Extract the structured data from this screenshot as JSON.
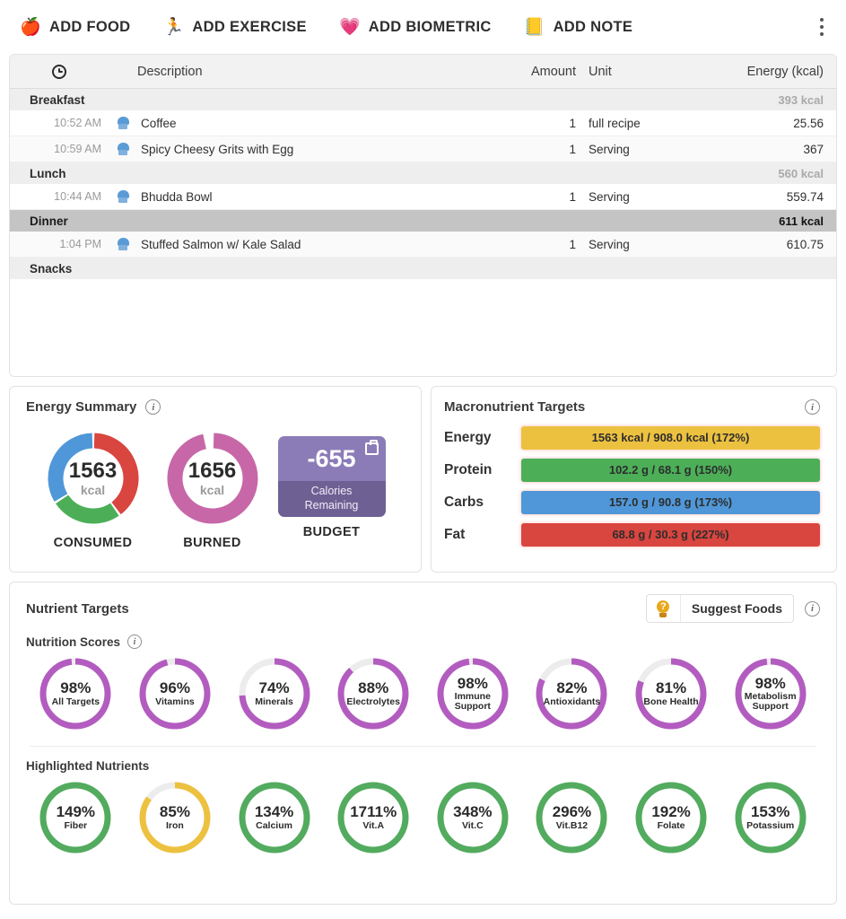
{
  "toolbar": {
    "actions": [
      {
        "label": "ADD FOOD",
        "icon": "apple-icon",
        "glyph": "🍎"
      },
      {
        "label": "ADD EXERCISE",
        "icon": "runner-icon",
        "glyph": "🏃"
      },
      {
        "label": "ADD BIOMETRIC",
        "icon": "heart-pulse-icon",
        "glyph": "💗"
      },
      {
        "label": "ADD NOTE",
        "icon": "note-icon",
        "glyph": "📒"
      }
    ],
    "overflow_icon": "kebab-menu-icon"
  },
  "log": {
    "columns": {
      "time": "",
      "time_icon": "clock-icon",
      "description": "Description",
      "amount": "Amount",
      "unit": "Unit",
      "energy": "Energy (kcal)"
    },
    "sections": [
      {
        "name": "Breakfast",
        "kcal": "393 kcal",
        "highlighted": false,
        "items": [
          {
            "time": "10:52 AM",
            "icon": "chef-hat-icon",
            "description": "Coffee",
            "amount": "1",
            "unit": "full recipe",
            "energy": "25.56"
          },
          {
            "time": "10:59 AM",
            "icon": "chef-hat-icon",
            "description": "Spicy Cheesy Grits with Egg",
            "amount": "1",
            "unit": "Serving",
            "energy": "367"
          }
        ]
      },
      {
        "name": "Lunch",
        "kcal": "560 kcal",
        "highlighted": false,
        "items": [
          {
            "time": "10:44 AM",
            "icon": "chef-hat-icon",
            "description": "Bhudda Bowl",
            "amount": "1",
            "unit": "Serving",
            "energy": "559.74"
          }
        ]
      },
      {
        "name": "Dinner",
        "kcal": "611 kcal",
        "highlighted": true,
        "items": [
          {
            "time": "1:04 PM",
            "icon": "chef-hat-icon",
            "description": "Stuffed Salmon w/ Kale Salad",
            "amount": "1",
            "unit": "Serving",
            "energy": "610.75"
          }
        ]
      },
      {
        "name": "Snacks",
        "kcal": "",
        "highlighted": false,
        "items": []
      }
    ]
  },
  "energy_summary": {
    "title": "Energy Summary",
    "info_icon": "info-icon",
    "consumed": {
      "value": "1563",
      "unit": "kcal",
      "caption": "CONSUMED",
      "segments": [
        {
          "name": "Fat",
          "percent": 40,
          "color": "#d9453f"
        },
        {
          "name": "Protein",
          "percent": 26,
          "color": "#4aa css"
        }
      ]
    },
    "burned": {
      "value": "1656",
      "unit": "kcal",
      "caption": "BURNED",
      "percent": 97,
      "color": "#c767a8"
    },
    "budget": {
      "value": "-655",
      "label_line1": "Calories",
      "label_line2": "Remaining",
      "caption": "BUDGET",
      "icon": "budget-bag-icon",
      "color_top": "#8b7cb8",
      "color_bottom": "#6f6094"
    }
  },
  "chart_data": [
    {
      "type": "pie",
      "title": "CONSUMED",
      "center_label": "1563 kcal",
      "categories": [
        "Fat",
        "Protein",
        "Carbs"
      ],
      "values": [
        40,
        26,
        34
      ],
      "colors": [
        "#d9453f",
        "#4caf58",
        "#4f97d8"
      ],
      "unit": "% of consumed energy"
    },
    {
      "type": "pie",
      "title": "BURNED",
      "center_label": "1656 kcal",
      "categories": [
        "Burned"
      ],
      "values": [
        97
      ],
      "colors": [
        "#c767a8"
      ],
      "unit": "%"
    },
    {
      "type": "bar",
      "title": "Macronutrient Targets",
      "categories": [
        "Energy",
        "Protein",
        "Carbs",
        "Fat"
      ],
      "values": [
        172,
        150,
        173,
        227
      ],
      "colors": [
        "#edc140",
        "#4aa css",
        "#4f97d8",
        "#d9453f"
      ],
      "ylabel": "% of target",
      "grid": false
    },
    {
      "type": "bar",
      "title": "Nutrition Scores",
      "categories": [
        "All Targets",
        "Vitamins",
        "Minerals",
        "Electrolytes",
        "Immune Support",
        "Antioxidants",
        "Bone Health",
        "Metabolism Support"
      ],
      "values": [
        98,
        96,
        74,
        88,
        98,
        82,
        81,
        98
      ],
      "ylabel": "%",
      "ylim": [
        0,
        100
      ]
    },
    {
      "type": "bar",
      "title": "Highlighted Nutrients",
      "categories": [
        "Fiber",
        "Iron",
        "Calcium",
        "Vit.A",
        "Vit.C",
        "Vit.B12",
        "Folate",
        "Potassium"
      ],
      "values": [
        149,
        85,
        134,
        1711,
        348,
        296,
        192,
        153
      ],
      "ylabel": "% of target"
    }
  ],
  "macro": {
    "title": "Macronutrient Targets",
    "info_icon": "info-icon",
    "rows": [
      {
        "name": "Energy",
        "text": "1563 kcal / 908.0 kcal (172%)",
        "percent": 172,
        "color": "#edc140"
      },
      {
        "name": "Protein",
        "text": "102.2 g / 68.1 g (150%)",
        "percent": 150,
        "color": "#4caf58"
      },
      {
        "name": "Carbs",
        "text": "157.0 g / 90.8 g (173%)",
        "percent": 173,
        "color": "#4f97d8"
      },
      {
        "name": "Fat",
        "text": "68.8 g / 30.3 g (227%)",
        "percent": 227,
        "color": "#d9453f"
      }
    ]
  },
  "nutrient_targets": {
    "title": "Nutrient Targets",
    "info_icon": "info-icon",
    "suggest_button": {
      "label": "Suggest Foods",
      "icon": "lightbulb-question-icon"
    },
    "scores": {
      "title": "Nutrition Scores",
      "info_icon": "info-icon",
      "color": "#b35cc0",
      "track": "#ececec",
      "items": [
        {
          "pct": "98%",
          "value": 98,
          "name": "All Targets"
        },
        {
          "pct": "96%",
          "value": 96,
          "name": "Vitamins"
        },
        {
          "pct": "74%",
          "value": 74,
          "name": "Minerals"
        },
        {
          "pct": "88%",
          "value": 88,
          "name": "Electrolytes"
        },
        {
          "pct": "98%",
          "value": 98,
          "name": "Immune Support"
        },
        {
          "pct": "82%",
          "value": 82,
          "name": "Antioxidants"
        },
        {
          "pct": "81%",
          "value": 81,
          "name": "Bone Health"
        },
        {
          "pct": "98%",
          "value": 98,
          "name": "Metabolism Support"
        }
      ]
    },
    "highlighted": {
      "title": "Highlighted Nutrients",
      "green": "#52ab5e",
      "amber": "#edc140",
      "track": "#ececec",
      "items": [
        {
          "pct": "149%",
          "value": 100,
          "name": "Fiber",
          "color": "green"
        },
        {
          "pct": "85%",
          "value": 85,
          "name": "Iron",
          "color": "amber"
        },
        {
          "pct": "134%",
          "value": 100,
          "name": "Calcium",
          "color": "green"
        },
        {
          "pct": "1711%",
          "value": 100,
          "name": "Vit.A",
          "color": "green"
        },
        {
          "pct": "348%",
          "value": 100,
          "name": "Vit.C",
          "color": "green"
        },
        {
          "pct": "296%",
          "value": 100,
          "name": "Vit.B12",
          "color": "green"
        },
        {
          "pct": "192%",
          "value": 100,
          "name": "Folate",
          "color": "green"
        },
        {
          "pct": "153%",
          "value": 100,
          "name": "Potassium",
          "color": "green"
        }
      ]
    }
  }
}
